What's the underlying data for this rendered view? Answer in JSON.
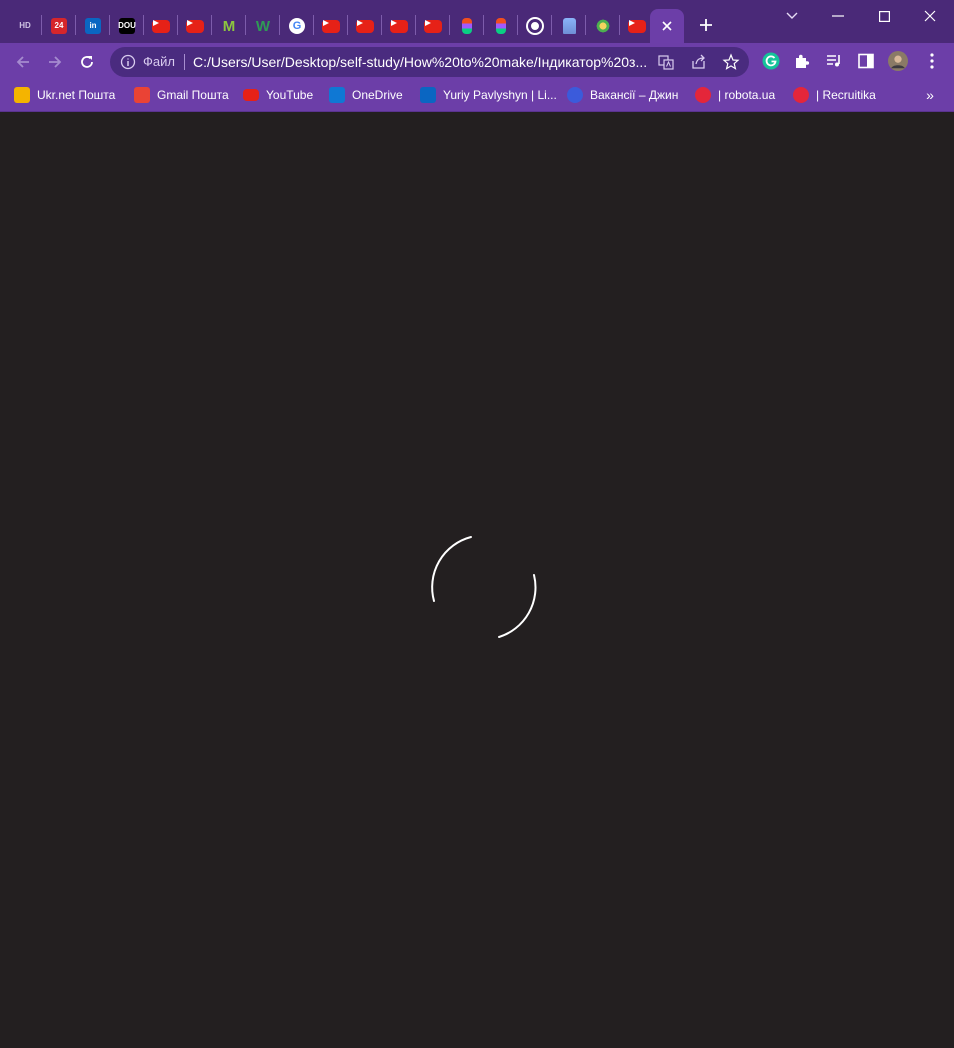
{
  "tabs": [
    {
      "icon": "hd-icon",
      "text": "HD",
      "bg": "transparent",
      "fg": "#cfc3e3"
    },
    {
      "icon": "news24-icon",
      "text": "24",
      "bg": "#d6262b",
      "fg": "#ffffff"
    },
    {
      "icon": "linkedin-icon",
      "text": "in",
      "bg": "#0a66c2",
      "fg": "#ffffff"
    },
    {
      "icon": "dou-icon",
      "text": "DOU",
      "bg": "#000000",
      "fg": "#ffffff"
    },
    {
      "icon": "youtube-icon",
      "text": "",
      "bg": "#e62117",
      "fg": "#ffffff"
    },
    {
      "icon": "youtube-icon",
      "text": "",
      "bg": "#e62117",
      "fg": "#ffffff"
    },
    {
      "icon": "m-icon",
      "text": "M",
      "bg": "transparent",
      "fg": "#8dc63f"
    },
    {
      "icon": "w-icon",
      "text": "W",
      "bg": "transparent",
      "fg": "#2f9a55"
    },
    {
      "icon": "google-icon",
      "text": "G",
      "bg": "#ffffff",
      "fg": "#4285f4"
    },
    {
      "icon": "youtube-icon",
      "text": "",
      "bg": "#e62117",
      "fg": "#ffffff"
    },
    {
      "icon": "youtube-icon",
      "text": "",
      "bg": "#e62117",
      "fg": "#ffffff"
    },
    {
      "icon": "youtube-icon",
      "text": "",
      "bg": "#e62117",
      "fg": "#ffffff"
    },
    {
      "icon": "youtube-icon",
      "text": "",
      "bg": "#e62117",
      "fg": "#ffffff"
    },
    {
      "icon": "figma-icon",
      "text": "",
      "bg": "transparent",
      "fg": "#ffffff"
    },
    {
      "icon": "figma-icon",
      "text": "",
      "bg": "transparent",
      "fg": "#ffffff"
    },
    {
      "icon": "globe-icon",
      "text": "",
      "bg": "transparent",
      "fg": "#ffffff"
    },
    {
      "icon": "pagoda-icon",
      "text": "",
      "bg": "transparent",
      "fg": "#ffffff"
    },
    {
      "icon": "emblem-icon",
      "text": "",
      "bg": "transparent",
      "fg": "#ffffff"
    },
    {
      "icon": "youtube-icon",
      "text": "",
      "bg": "#e62117",
      "fg": "#ffffff"
    }
  ],
  "active_tab": {
    "close_icon": "close-icon"
  },
  "window_controls": [
    "chevron-down-icon",
    "minimize-icon",
    "maximize-icon",
    "close-icon"
  ],
  "toolbar": {
    "scheme_label": "Файл",
    "url": "C:/Users/User/Desktop/self-study/How%20to%20make/Індикатор%20з..."
  },
  "bookmarks": [
    {
      "label": "Ukr.net Пошта",
      "icon": "ukrnet-icon",
      "color": "#f4b400"
    },
    {
      "label": "Gmail Пошта",
      "icon": "gmail-icon",
      "color": "#ea4335"
    },
    {
      "label": "YouTube",
      "icon": "youtube-icon",
      "color": "#e62117"
    },
    {
      "label": "OneDrive",
      "icon": "onedrive-icon",
      "color": "#0f78d4"
    },
    {
      "label": "Yuriy Pavlyshyn | Li...",
      "icon": "linkedin-icon",
      "color": "#0a66c2"
    },
    {
      "label": "Вакансії – Джин",
      "icon": "djinni-icon",
      "color": "#3b5bdb"
    },
    {
      "label": "| robota.ua",
      "icon": "robota-icon",
      "color": "#e4263a"
    },
    {
      "label": "| Recruitika",
      "icon": "recruitika-icon",
      "color": "#e4263a"
    }
  ],
  "colors": {
    "tabbar": "#4a2978",
    "toolbar": "#6c3ea8",
    "omnibox": "#4a2b7f",
    "page_bg": "#231f20",
    "spinner": "#ffffff"
  }
}
